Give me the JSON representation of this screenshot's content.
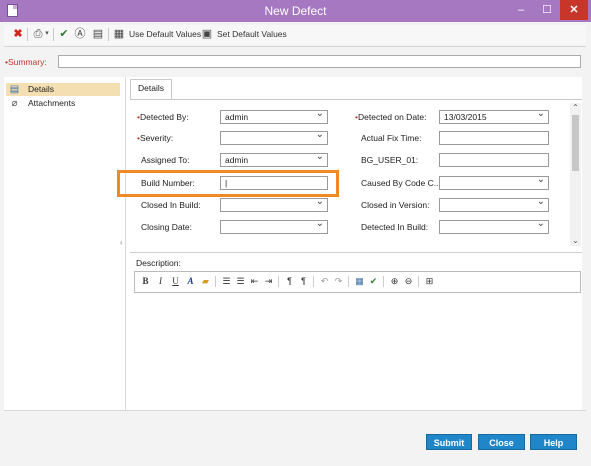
{
  "window": {
    "title": "New Defect",
    "min_glyph": "–",
    "max_glyph": "☐",
    "close_glyph": "✕"
  },
  "toolbar": {
    "use_default_label": "Use Default Values",
    "set_default_label": "Set Default Values",
    "icons": [
      "delete-icon",
      "print-icon",
      "spellcheck-icon",
      "spellcheck-options-icon",
      "clipboard-icon",
      "use-default-values-icon",
      "set-default-values-icon"
    ]
  },
  "summary": {
    "label": "Summary:",
    "value": ""
  },
  "nav": {
    "items": [
      {
        "label": "Details",
        "selected": true
      },
      {
        "label": "Attachments",
        "selected": false
      }
    ]
  },
  "tab": {
    "label": "Details"
  },
  "fields": {
    "detected_by": {
      "label": "Detected By:",
      "value": "admin",
      "required": true
    },
    "severity": {
      "label": "Severity:",
      "value": "",
      "required": true
    },
    "assigned_to": {
      "label": "Assigned To:",
      "value": "admin"
    },
    "build_number": {
      "label": "Build Number:",
      "value": "|"
    },
    "closed_in_build": {
      "label": "Closed In Build:",
      "value": ""
    },
    "closing_date": {
      "label": "Closing Date:",
      "value": ""
    },
    "detected_on_date": {
      "label": "Detected on Date:",
      "value": "13/03/2015",
      "required": true
    },
    "actual_fix_time": {
      "label": "Actual Fix Time:",
      "value": ""
    },
    "bg_user_01": {
      "label": "BG_USER_01:",
      "value": ""
    },
    "caused_by_code": {
      "label": "Caused By Code C..",
      "value": ""
    },
    "closed_in_version": {
      "label": "Closed in Version:",
      "value": ""
    },
    "detected_in_build": {
      "label": "Detected In Build:",
      "value": ""
    }
  },
  "description": {
    "label": "Description:"
  },
  "format_bar": {
    "bold": "B",
    "italic": "I",
    "underline": "U",
    "font_color": "A"
  },
  "buttons": {
    "submit": "Submit",
    "close": "Close",
    "help": "Help"
  },
  "colors": {
    "titlebar": "#a678c2",
    "accent_button": "#1f86c9",
    "highlight": "#f08a24",
    "required": "#c0392b"
  }
}
